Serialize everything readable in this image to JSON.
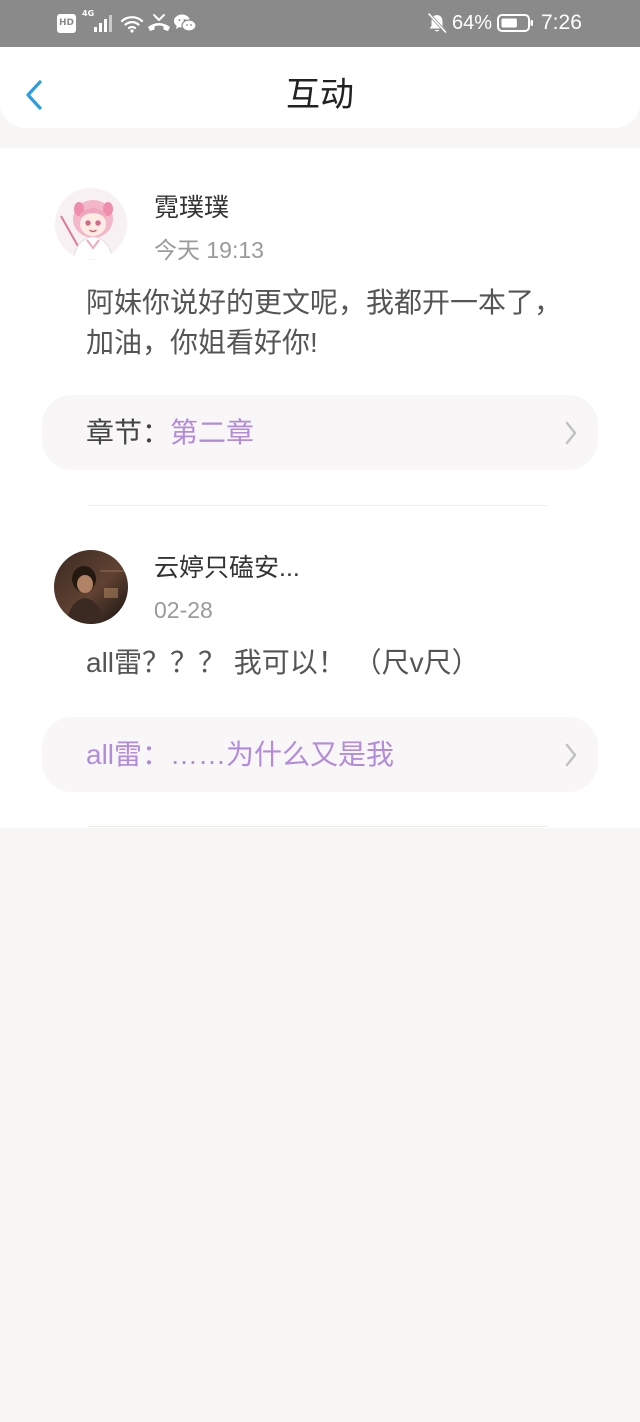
{
  "status_bar": {
    "hd_badge": "HD",
    "network_type": "4G",
    "icons": [
      "hd-icon",
      "signal-4g-icon",
      "wifi-icon",
      "missed-call-icon",
      "wechat-icon",
      "bell-off-icon",
      "battery-icon"
    ],
    "battery_percent": "64%",
    "battery_level": 0.64,
    "time": "7:26"
  },
  "header": {
    "back_icon": "chevron-left-icon",
    "title": "互动"
  },
  "comments": [
    {
      "name": "霓璞璞",
      "time": "今天 19:13",
      "text_lines": [
        "阿妹你说好的更文呢，我都开一本了，",
        "加油，你姐看好你!"
      ],
      "ref_label": "章节：",
      "ref_value": "第二章"
    },
    {
      "name": "云婷只磕安...",
      "time": "02-28",
      "text_lines": [
        "all雷？？？ 我可以！ （尺v尺）"
      ],
      "ref_label": "all雷：",
      "ref_value": "……为什么又是我"
    }
  ],
  "colors": {
    "accent_blue": "#2b9de0",
    "ref_purple": "#b28cdb",
    "status_bar_bg": "#8a8a8a",
    "page_bg": "#f8f5f5"
  }
}
